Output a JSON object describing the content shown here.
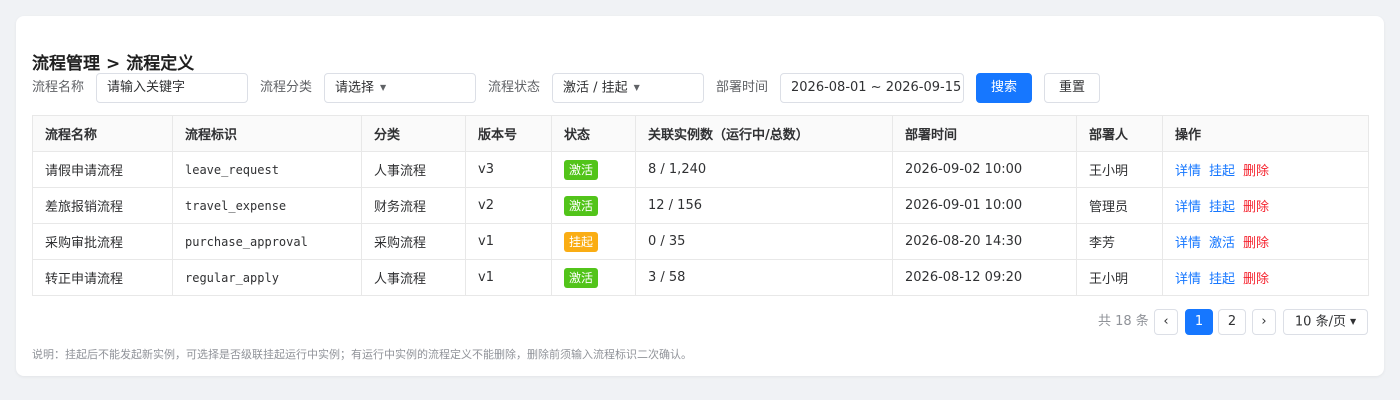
{
  "breadcrumb": {
    "parent": "流程管理",
    "separator": ">",
    "current": "流程定义"
  },
  "filters": {
    "name_label": "流程名称",
    "name_placeholder": "请输入关键字",
    "category_label": "流程分类",
    "category_value": "请选择",
    "status_label": "流程状态",
    "status_value": "激活 / 挂起",
    "deploy_label": "部署时间",
    "deploy_range": "2026-08-01 ~ 2026-09-15",
    "search_label": "搜索",
    "reset_label": "重置"
  },
  "table": {
    "headers": [
      "流程名称",
      "流程标识",
      "分类",
      "版本号",
      "状态",
      "关联实例数（运行中/总数）",
      "部署时间",
      "部署人",
      "操作"
    ],
    "rows": [
      {
        "name": "请假申请流程",
        "key": "leave_request",
        "category": "人事流程",
        "version": "v3",
        "status": "激活",
        "instances": "8 / 1,240",
        "deploy_time": "2026-09-02 10:00",
        "deployer": "王小明",
        "op_detail": "详情",
        "op_toggle": "挂起",
        "op_delete": "删除"
      },
      {
        "name": "差旅报销流程",
        "key": "travel_expense",
        "category": "财务流程",
        "version": "v2",
        "status": "激活",
        "instances": "12 / 156",
        "deploy_time": "2026-09-01 10:00",
        "deployer": "管理员",
        "op_detail": "详情",
        "op_toggle": "挂起",
        "op_delete": "删除"
      },
      {
        "name": "采购审批流程",
        "key": "purchase_approval",
        "category": "采购流程",
        "version": "v1",
        "status": "挂起",
        "instances": "0 / 35",
        "deploy_time": "2026-08-20 14:30",
        "deployer": "李芳",
        "op_detail": "详情",
        "op_toggle": "激活",
        "op_delete": "删除"
      },
      {
        "name": "转正申请流程",
        "key": "regular_apply",
        "category": "人事流程",
        "version": "v1",
        "status": "激活",
        "instances": "3 / 58",
        "deploy_time": "2026-08-12 09:20",
        "deployer": "王小明",
        "op_detail": "详情",
        "op_toggle": "挂起",
        "op_delete": "删除"
      }
    ]
  },
  "pagination": {
    "total": "共 18 条",
    "prev": "‹",
    "pages": [
      "1",
      "2"
    ],
    "current_page": "1",
    "next": "›",
    "page_size": "10 条/页"
  },
  "note": "说明：挂起后不能发起新实例，可选择是否级联挂起运行中实例；有运行中实例的流程定义不能删除，删除前须输入流程标识二次确认。",
  "colors": {
    "primary": "#1677ff",
    "active_tag": "#52c41a",
    "suspend_tag": "#faad14",
    "danger": "#f5222d"
  },
  "icons": {
    "caret": "caret-down-icon"
  }
}
